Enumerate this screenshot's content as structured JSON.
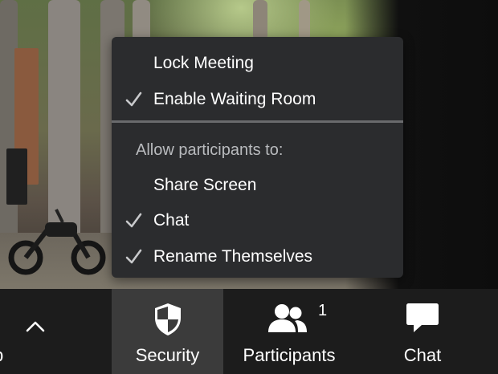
{
  "menu": {
    "items": [
      {
        "label": "Lock Meeting",
        "checked": false
      },
      {
        "label": "Enable Waiting Room",
        "checked": true
      }
    ],
    "section_heading": "Allow participants to:",
    "permissions": [
      {
        "label": "Share Screen",
        "checked": false
      },
      {
        "label": "Chat",
        "checked": true
      },
      {
        "label": "Rename Themselves",
        "checked": true
      }
    ]
  },
  "toolbar": {
    "partial_label": "p",
    "security_label": "Security",
    "participants_label": "Participants",
    "participants_count": "1",
    "chat_label": "Chat"
  },
  "colors": {
    "menu_bg": "#2b2c2e",
    "toolbar_bg": "#1c1c1c",
    "active_button_bg": "#3b3b3b",
    "check_color": "#c8c9cb"
  }
}
